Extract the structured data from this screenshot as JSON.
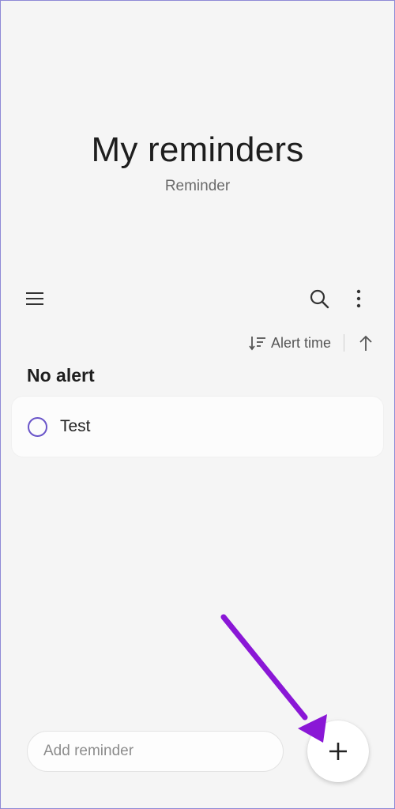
{
  "header": {
    "title": "My reminders",
    "subtitle": "Reminder"
  },
  "toolbar": {
    "menu_icon": "hamburger-menu-icon",
    "search_icon": "search-icon",
    "more_icon": "more-vertical-icon"
  },
  "sort": {
    "label": "Alert time",
    "sort_icon": "sort-icon",
    "direction_icon": "arrow-up-icon"
  },
  "section": {
    "title": "No alert"
  },
  "reminders": [
    {
      "text": "Test",
      "done": false
    }
  ],
  "add": {
    "placeholder": "Add reminder",
    "fab_icon": "plus-icon"
  },
  "colors": {
    "accent": "#6a55c9",
    "annotation_arrow": "#8a17d6",
    "background": "#f5f5f5"
  }
}
